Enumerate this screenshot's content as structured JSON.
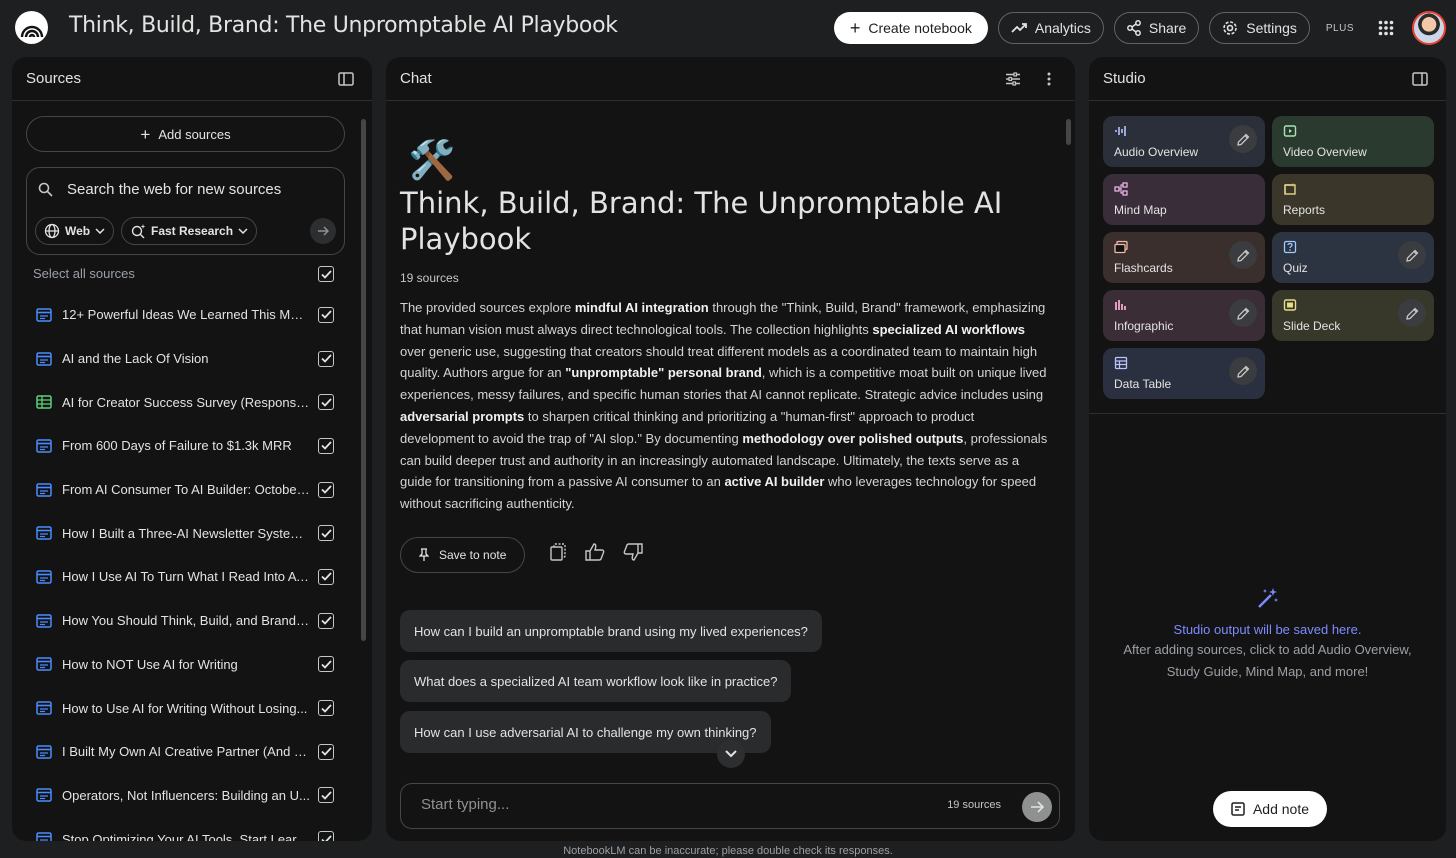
{
  "header": {
    "title": "Think, Build, Brand: The Unpromptable AI Playbook",
    "create_label": "Create notebook",
    "analytics_label": "Analytics",
    "share_label": "Share",
    "settings_label": "Settings",
    "plan_badge": "PLUS"
  },
  "sources": {
    "panel_title": "Sources",
    "add_label": "Add sources",
    "search_placeholder": "Search the web for new sources",
    "web_chip": "Web",
    "research_chip": "Fast Research",
    "select_all": "Select all sources",
    "items": [
      {
        "label": "12+ Powerful Ideas We Learned This Mon...",
        "type": "doc"
      },
      {
        "label": "AI and the Lack Of Vision",
        "type": "doc"
      },
      {
        "label": "AI for Creator Success Survey (Response...",
        "type": "sheet"
      },
      {
        "label": "From 600 Days of Failure to $1.3k MRR",
        "type": "doc"
      },
      {
        "label": "From AI Consumer To AI Builder: October...",
        "type": "doc"
      },
      {
        "label": "How I Built a Three-AI Newsletter System...",
        "type": "doc"
      },
      {
        "label": "How I Use AI To Turn What I Read Into A L...",
        "type": "doc"
      },
      {
        "label": "How You Should Think, Build, and Brand ...",
        "type": "doc"
      },
      {
        "label": "How to NOT Use AI for Writing",
        "type": "doc"
      },
      {
        "label": "How to Use AI for Writing Without Losing...",
        "type": "doc"
      },
      {
        "label": "I Built My Own AI Creative Partner (And It...",
        "type": "doc"
      },
      {
        "label": "Operators, Not Influencers: Building an U...",
        "type": "doc"
      },
      {
        "label": "Stop Optimizing Your AI Tools. Start Lear...",
        "type": "doc"
      }
    ]
  },
  "chat": {
    "panel_title": "Chat",
    "emoji": "🛠️",
    "title": "Think, Build, Brand: The Unpromptable AI Playbook",
    "source_count": "19 sources",
    "summary_parts": [
      {
        "t": "The provided sources explore ",
        "b": false
      },
      {
        "t": "mindful AI integration",
        "b": true
      },
      {
        "t": " through the \"Think, Build, Brand\" framework, emphasizing that human vision must always direct technological tools. The collection highlights ",
        "b": false
      },
      {
        "t": "specialized AI workflows",
        "b": true
      },
      {
        "t": " over generic use, suggesting that creators should treat different models as a coordinated team to maintain high quality. Authors argue for an ",
        "b": false
      },
      {
        "t": "\"unpromptable\" personal brand",
        "b": true
      },
      {
        "t": ", which is a competitive moat built on unique lived experiences, messy failures, and specific human stories that AI cannot replicate. Strategic advice includes using ",
        "b": false
      },
      {
        "t": "adversarial prompts",
        "b": true
      },
      {
        "t": " to sharpen critical thinking and prioritizing a \"human-first\" approach to product development to avoid the trap of \"AI slop.\" By documenting ",
        "b": false
      },
      {
        "t": "methodology over polished outputs",
        "b": true
      },
      {
        "t": ", professionals can build deeper trust and authority in an increasingly automated landscape. Ultimately, the texts serve as a guide for transitioning from a passive AI consumer to an ",
        "b": false
      },
      {
        "t": "active AI builder",
        "b": true
      },
      {
        "t": " who leverages technology for speed without sacrificing authenticity.",
        "b": false
      }
    ],
    "save_label": "Save to note",
    "suggestions": [
      "How can I build an unpromptable brand using my lived experiences?",
      "What does a specialized AI team workflow look like in practice?",
      "How can I use adversarial AI to challenge my own thinking?"
    ],
    "input_placeholder": "Start typing...",
    "input_count": "19 sources",
    "disclaimer": "NotebookLM can be inaccurate; please double check its responses."
  },
  "studio": {
    "panel_title": "Studio",
    "tiles": [
      {
        "label": "Audio Overview",
        "icon": "audio-icon",
        "bg": "#2b2f3a",
        "color": "#b9c3ff",
        "edit": true
      },
      {
        "label": "Video Overview",
        "icon": "video-icon",
        "bg": "#2b3a2f",
        "color": "#a8e6b0",
        "edit": false
      },
      {
        "label": "Mind Map",
        "icon": "mindmap-icon",
        "bg": "#3a2d3a",
        "color": "#e8b3e8",
        "edit": false
      },
      {
        "label": "Reports",
        "icon": "reports-icon",
        "bg": "#3a372a",
        "color": "#e6d38c",
        "edit": false
      },
      {
        "label": "Flashcards",
        "icon": "flashcards-icon",
        "bg": "#3a2f2d",
        "color": "#f2b8a6",
        "edit": true
      },
      {
        "label": "Quiz",
        "icon": "quiz-icon",
        "bg": "#2b3440",
        "color": "#9ecaff",
        "edit": true
      },
      {
        "label": "Infographic",
        "icon": "infographic-icon",
        "bg": "#3a2d36",
        "color": "#f0a8d0",
        "edit": true
      },
      {
        "label": "Slide Deck",
        "icon": "slides-icon",
        "bg": "#37372a",
        "color": "#e6dc8c",
        "edit": true
      },
      {
        "label": "Data Table",
        "icon": "table-icon",
        "bg": "#2b3040",
        "color": "#b6c6ff",
        "edit": true
      }
    ],
    "empty_title": "Studio output will be saved here.",
    "empty_desc": "After adding sources, click to add Audio Overview, Study Guide, Mind Map, and more!",
    "add_note_label": "Add note"
  },
  "colors": {
    "accent": "#7c8cff",
    "doc_icon": "#4a8cff",
    "sheet_icon": "#5bd17a"
  }
}
